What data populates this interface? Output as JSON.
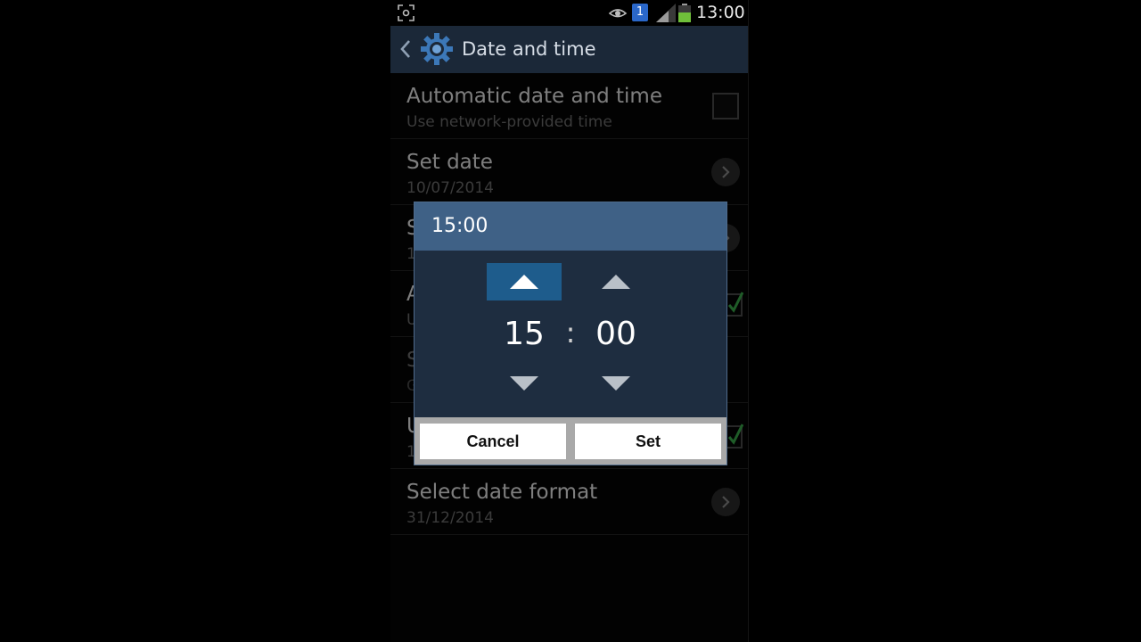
{
  "status_bar": {
    "notification_count": "1",
    "time": "13:00",
    "icons": [
      "screenshot-icon",
      "eye-icon",
      "signal-icon",
      "battery-icon"
    ]
  },
  "action_bar": {
    "title": "Date and time",
    "icons": [
      "back-icon",
      "gear-icon"
    ]
  },
  "settings": {
    "auto_date": {
      "title": "Automatic date and time",
      "subtitle": "Use network-provided time",
      "checked": false
    },
    "set_date": {
      "title": "Set date",
      "subtitle": "10/07/2014"
    },
    "set_time": {
      "title": "S",
      "subtitle": "1"
    },
    "auto_timezone": {
      "title": "A",
      "subtitle": "U",
      "checked": true
    },
    "select_timezone": {
      "title": "S",
      "subtitle": "G"
    },
    "use_24h": {
      "title": "U",
      "subtitle": "1",
      "checked": true
    },
    "date_format": {
      "title": "Select date format",
      "subtitle": "31/12/2014"
    }
  },
  "dialog": {
    "title": "15:00",
    "hour": "15",
    "separator": ":",
    "minute": "00",
    "cancel_label": "Cancel",
    "set_label": "Set"
  },
  "colors": {
    "action_bar": "#1b2838",
    "dialog_header": "#3f6186",
    "dialog_body": "#1e2d40",
    "spinner_active": "#1e5c8c",
    "check_green": "#3aa84a"
  }
}
